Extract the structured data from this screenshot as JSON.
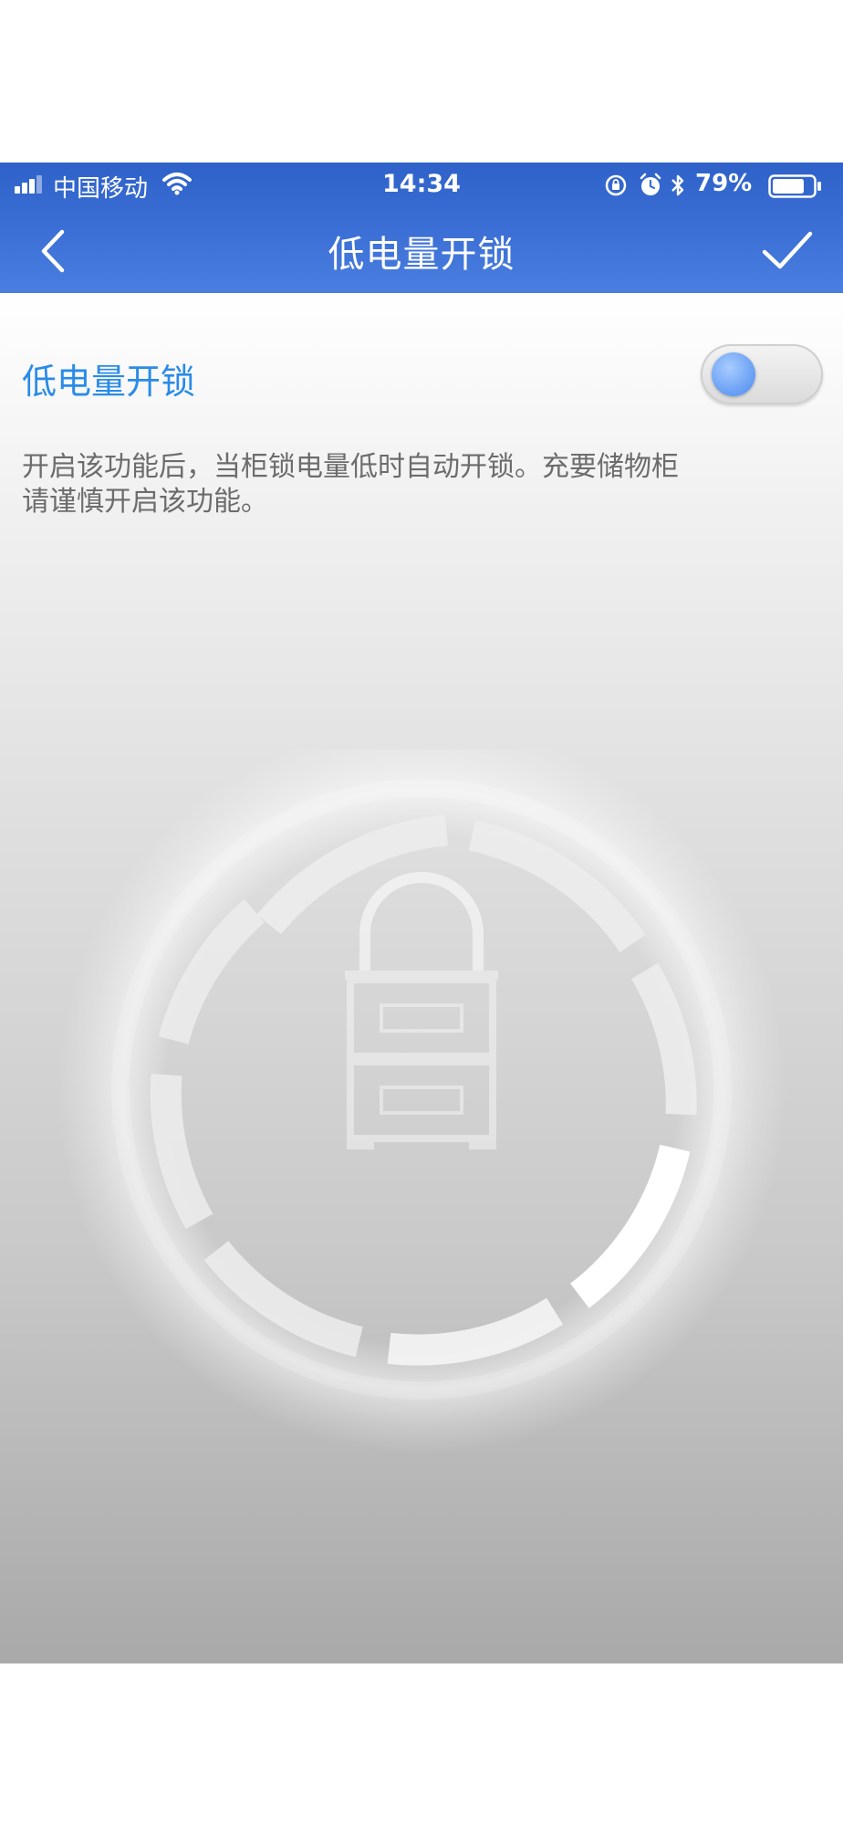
{
  "status_bar": {
    "carrier": "中国移动",
    "time": "14:34",
    "battery_percent": "79%",
    "battery_level": 0.79,
    "icons": [
      "signal-icon",
      "wifi-icon",
      "rotation-lock-icon",
      "alarm-icon",
      "bluetooth-icon",
      "battery-icon"
    ]
  },
  "nav": {
    "title": "低电量开锁",
    "back_icon": "chevron-left-icon",
    "confirm_icon": "checkmark-icon"
  },
  "setting": {
    "label": "低电量开锁",
    "toggle_on": false,
    "description": "开启该功能后，当柜锁电量低时自动开锁。充要储物柜请谨慎开启该功能。"
  },
  "colors": {
    "nav_bar": "#3c70d6",
    "label_accent": "#2a8be8",
    "description_text": "#6c6c6c",
    "toggle_knob": "#6ea4f5"
  },
  "illustration": {
    "icon": "cabinet-lock-icon"
  }
}
